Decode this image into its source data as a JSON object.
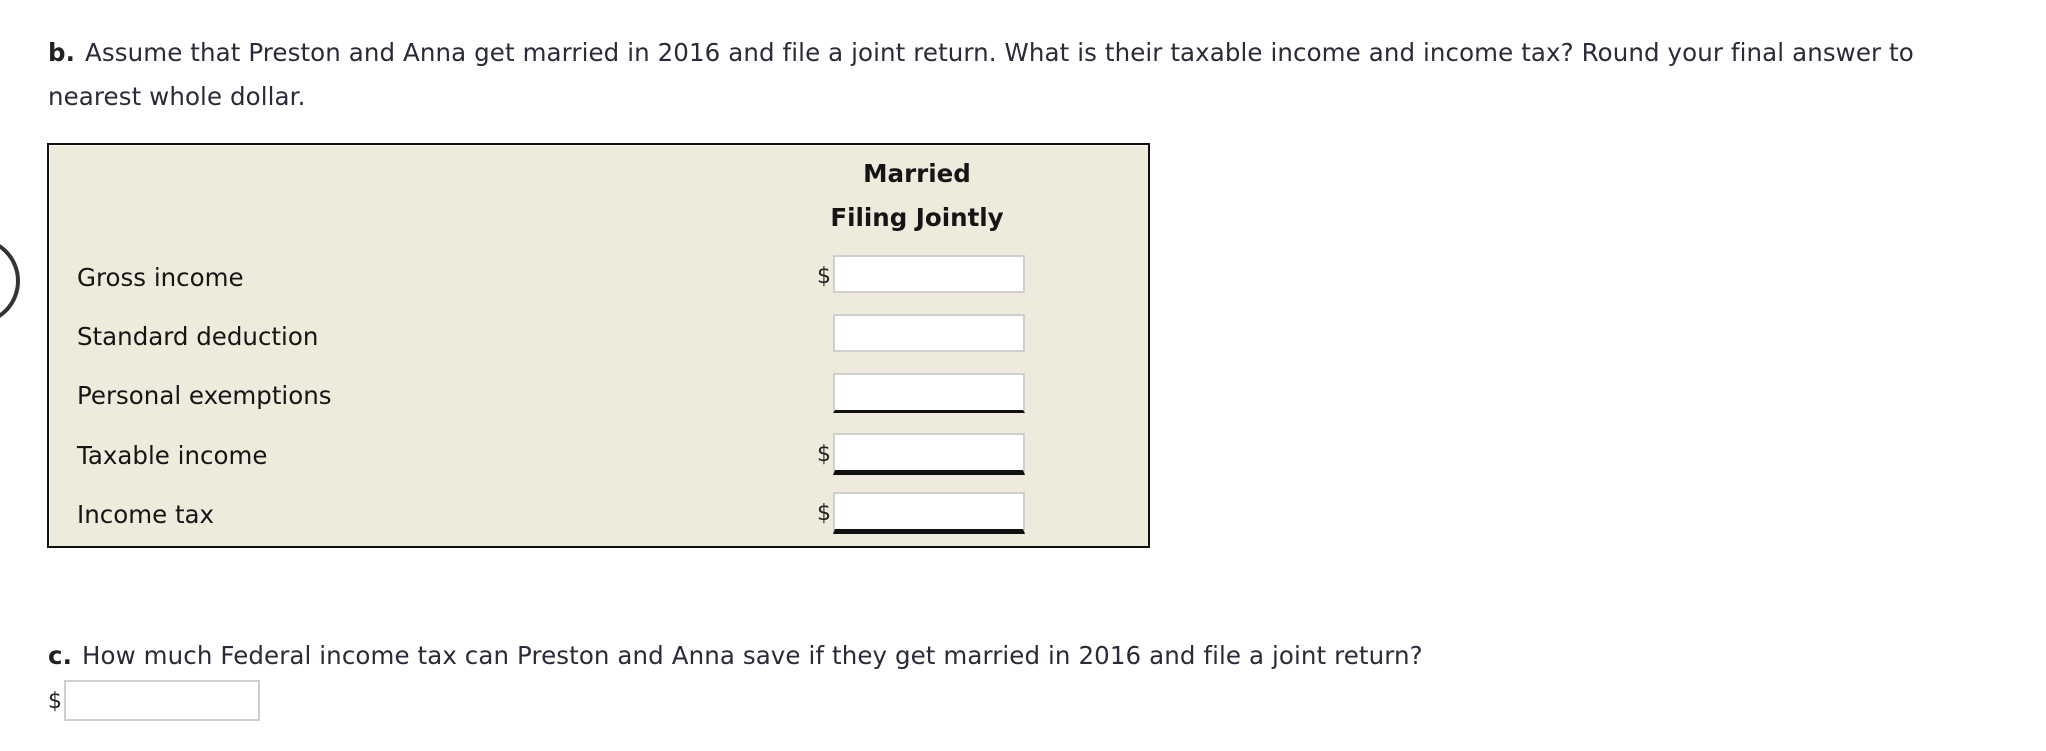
{
  "part_b": {
    "label": "b.",
    "text": "Assume that Preston and Anna get married in 2016 and file a joint return. What is their taxable income and income tax? Round your final answer to nearest whole dollar."
  },
  "table": {
    "column_header_line1": "Married",
    "column_header_line2": "Filing Jointly",
    "rows": [
      {
        "label": "Gross income",
        "currency": "$",
        "value": "",
        "placeholder": ""
      },
      {
        "label": "Standard deduction",
        "currency": "",
        "value": "",
        "placeholder": ""
      },
      {
        "label": "Personal exemptions",
        "currency": "",
        "value": "",
        "placeholder": ""
      },
      {
        "label": "Taxable income",
        "currency": "$",
        "value": "",
        "placeholder": ""
      },
      {
        "label": "Income tax",
        "currency": "$",
        "value": "",
        "placeholder": ""
      }
    ]
  },
  "part_c": {
    "label": "c.",
    "text": "How much Federal income tax can Preston and Anna save if they get married in 2016 and file a joint return?",
    "currency": "$",
    "value": "",
    "placeholder": ""
  },
  "icons": {
    "left_edge": "circle-icon"
  },
  "colors": {
    "table_background": "#eeebdc",
    "table_border": "#111111",
    "input_border": "#cfcfcf"
  }
}
